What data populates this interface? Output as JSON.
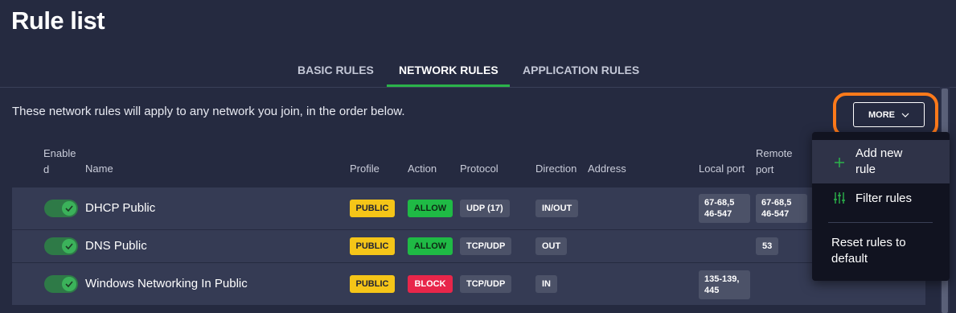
{
  "page": {
    "title": "Rule list"
  },
  "tabs": [
    {
      "label": "BASIC RULES",
      "active": false
    },
    {
      "label": "NETWORK RULES",
      "active": true
    },
    {
      "label": "APPLICATION RULES",
      "active": false
    }
  ],
  "intro_text": "These network rules will apply to any network you join, in the order below.",
  "more_button": {
    "label": "MORE",
    "highlight_color": "#ff7a1a"
  },
  "columns": {
    "enabled_line1": "Enable",
    "enabled_line2": "d",
    "name": "Name",
    "profile": "Profile",
    "action": "Action",
    "protocol": "Protocol",
    "direction": "Direction",
    "address": "Address",
    "local_port": "Local port",
    "remote_port_line1": "Remote",
    "remote_port_line2": "port"
  },
  "rules": [
    {
      "enabled": true,
      "name": "DHCP Public",
      "profile": "PUBLIC",
      "action": "ALLOW",
      "protocol": "UDP (17)",
      "direction": "IN/OUT",
      "local_port_line1": "67-68,5",
      "local_port_line2": "46-547",
      "remote_port_line1": "67-68,5",
      "remote_port_line2": "46-547"
    },
    {
      "enabled": true,
      "name": "DNS Public",
      "profile": "PUBLIC",
      "action": "ALLOW",
      "protocol": "TCP/UDP",
      "direction": "OUT",
      "remote_port": "53"
    },
    {
      "enabled": true,
      "name": "Windows Networking In Public",
      "profile": "PUBLIC",
      "action": "BLOCK",
      "protocol": "TCP/UDP",
      "direction": "IN",
      "local_port_line1": "135-139,",
      "local_port_line2": "445"
    }
  ],
  "more_menu": {
    "items": [
      {
        "label_line1": "Add new",
        "label_line2": "rule",
        "icon": "plus-icon"
      },
      {
        "label": "Filter rules",
        "icon": "sliders-icon"
      },
      {
        "label_line1": "Reset rules to",
        "label_line2": "default"
      }
    ]
  },
  "colors": {
    "background": "#252a40",
    "row": "#353b54",
    "accent_green": "#2bb34a",
    "public": "#f5c518",
    "allow": "#1fba45",
    "block": "#e8264a"
  }
}
